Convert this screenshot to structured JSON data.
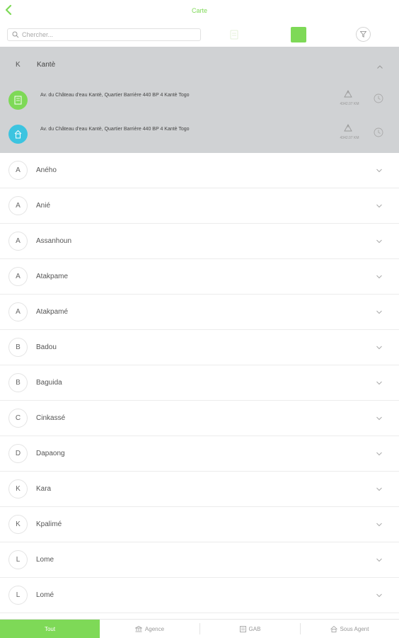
{
  "header": {
    "title": "Carte"
  },
  "search": {
    "placeholder": "Chercher..."
  },
  "expanded_group": {
    "letter": "K",
    "name": "Kantè",
    "locations": [
      {
        "type": "agence",
        "color": "#7ed957",
        "address": "Av. du Château d'eau Kantè, Quartier Barrière 440 BP 4 Kantè Togo",
        "distance": "4342.07 KM"
      },
      {
        "type": "sous-agent",
        "color": "#3cc4e0",
        "address": "Av. du Château d'eau Kantè, Quartier Barrière 440 BP 4 Kantè Togo",
        "distance": "4342.07 KM"
      }
    ]
  },
  "cities": [
    {
      "letter": "A",
      "name": "Aného"
    },
    {
      "letter": "A",
      "name": "Anié"
    },
    {
      "letter": "A",
      "name": "Assanhoun"
    },
    {
      "letter": "A",
      "name": "Atakpame"
    },
    {
      "letter": "A",
      "name": "Atakpamé"
    },
    {
      "letter": "B",
      "name": "Badou"
    },
    {
      "letter": "B",
      "name": "Baguida"
    },
    {
      "letter": "C",
      "name": "Cinkassé"
    },
    {
      "letter": "D",
      "name": "Dapaong"
    },
    {
      "letter": "K",
      "name": "Kara"
    },
    {
      "letter": "K",
      "name": "Kpalimé"
    },
    {
      "letter": "L",
      "name": "Lome"
    },
    {
      "letter": "L",
      "name": "Lomé"
    }
  ],
  "tabs": [
    {
      "label": "Tout",
      "icon": "none",
      "active": true
    },
    {
      "label": "Agence",
      "icon": "bank-icon",
      "active": false
    },
    {
      "label": "GAB",
      "icon": "atm-icon",
      "active": false
    },
    {
      "label": "Sous Agent",
      "icon": "house-icon",
      "active": false
    }
  ],
  "colors": {
    "accent": "#7ed957",
    "secondary": "#3cc4e0",
    "expanded_bg": "#d0d2d4"
  }
}
